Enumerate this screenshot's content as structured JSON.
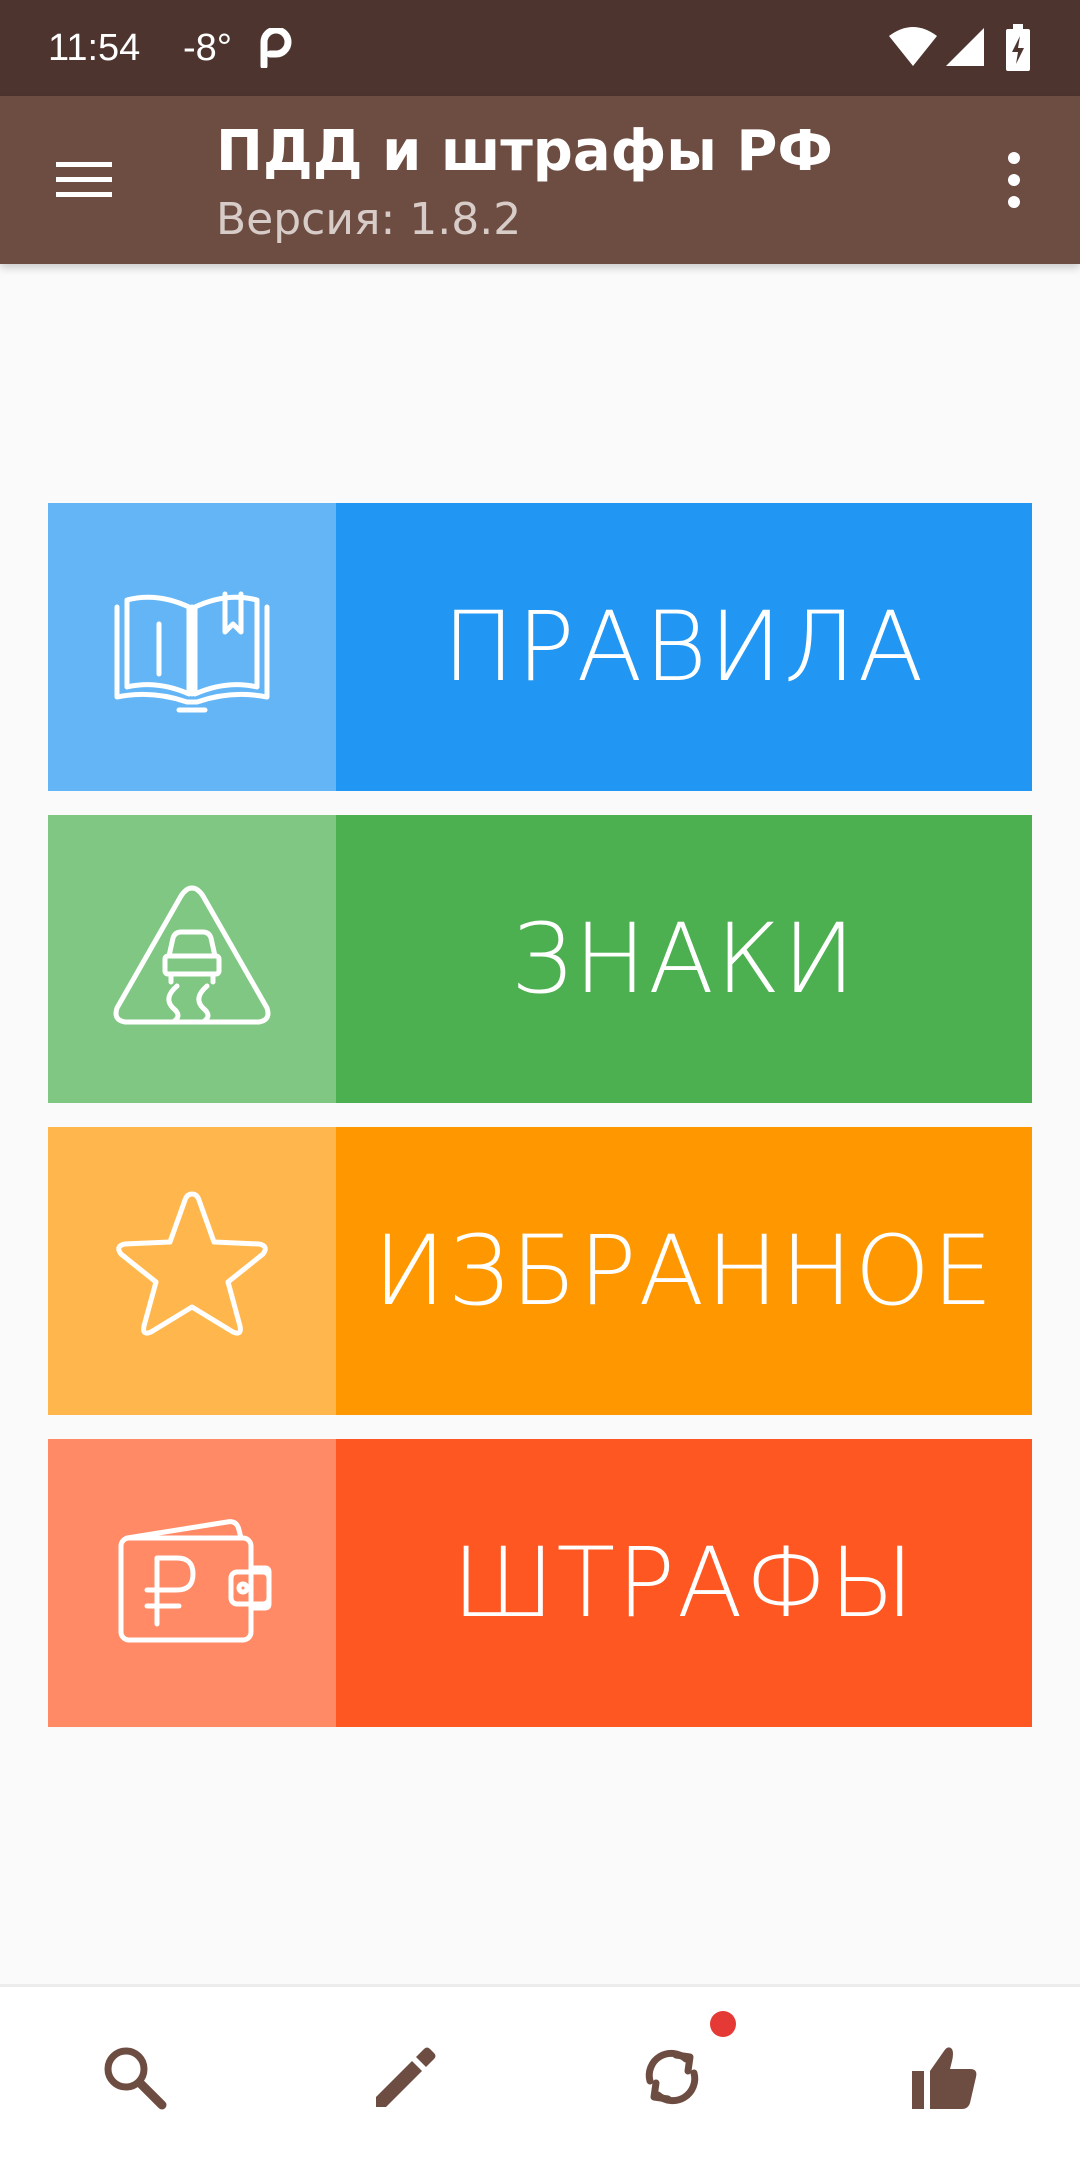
{
  "status_bar": {
    "time": "11:54",
    "temperature": "-8°",
    "icons": [
      "p-app-icon",
      "wifi-icon",
      "cell-signal-icon",
      "battery-charging-icon"
    ]
  },
  "app_bar": {
    "title": "ПДД и штрафы РФ",
    "subtitle": "Версия: 1.8.2",
    "icons": [
      "menu-icon",
      "overflow-menu-icon"
    ]
  },
  "tiles": [
    {
      "label": "ПРАВИЛА",
      "icon": "open-book-icon",
      "accent": "#2196f3",
      "accent_light": "#64b5f6"
    },
    {
      "label": "ЗНАКИ",
      "icon": "slippery-road-sign-icon",
      "accent": "#4caf50",
      "accent_light": "#81c784"
    },
    {
      "label": "ИЗБРАННОЕ",
      "icon": "star-icon",
      "accent": "#ff9800",
      "accent_light": "#ffb74d"
    },
    {
      "label": "ШТРАФЫ",
      "icon": "ruble-wallet-icon",
      "accent": "#ff5722",
      "accent_light": "#ff8a65"
    }
  ],
  "bottom_nav": {
    "icons": [
      "search-icon",
      "pencil-icon",
      "sync-icon",
      "thumbs-up-icon"
    ],
    "icon_color": "#6d4c41",
    "badge_color": "#e53935"
  },
  "colors": {
    "status_bar": "#4e342e",
    "app_bar": "#6d4c41",
    "background": "#fafafa"
  }
}
